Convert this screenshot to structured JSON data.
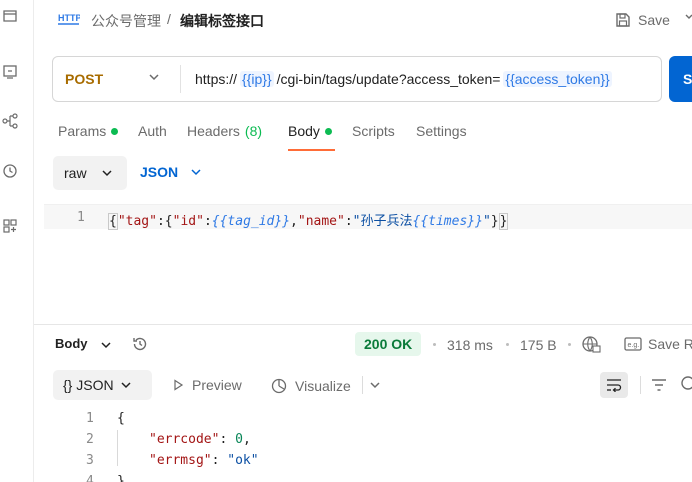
{
  "breadcrumb": {
    "parent": "公众号管理",
    "separator": "/",
    "current": "编辑标签接口"
  },
  "header": {
    "save_label": "Save"
  },
  "request": {
    "method": "POST",
    "url_prefix": "https://",
    "var_ip": "{{ip}}",
    "url_path": "/cgi-bin/tags/update?access_token=",
    "var_token": "{{access_token}}",
    "send_label": "S"
  },
  "tabs": {
    "params": "Params",
    "auth": "Auth",
    "headers": "Headers",
    "headers_count": "(8)",
    "body": "Body",
    "scripts": "Scripts",
    "settings": "Settings"
  },
  "body_mode": {
    "raw": "raw",
    "json": "JSON"
  },
  "editor": {
    "line_no": "1",
    "p1": "{",
    "p2": "\"tag\"",
    "p3": ":{",
    "p4": "\"id\"",
    "p5": ":",
    "p6": "{{tag_id}}",
    "p7": ",",
    "p8": "\"name\"",
    "p9": ":",
    "p10": "\"孙子兵法",
    "p11": "{{times}}",
    "p12": "\"",
    "p13": "}",
    "p14": "}"
  },
  "response": {
    "title": "Body",
    "status": "200 OK",
    "time": "318 ms",
    "size": "175 B",
    "save_label": "Save R",
    "format_label": "{} JSON",
    "preview_label": "Preview",
    "visualize_label": "Visualize",
    "lines": {
      "n1": "1",
      "n2": "2",
      "n3": "3",
      "n4": "4",
      "l1": "{",
      "l2_key": "\"errcode\"",
      "l2_sep": ": ",
      "l2_val": "0",
      "l2_end": ",",
      "l3_key": "\"errmsg\"",
      "l3_sep": ": ",
      "l3_val": "\"ok\"",
      "l4": "}"
    }
  },
  "colors": {
    "accent_orange": "#ff6c37",
    "method_post": "#a86c00",
    "primary_blue": "#0265d2",
    "status_green": "#0a7b3a"
  }
}
